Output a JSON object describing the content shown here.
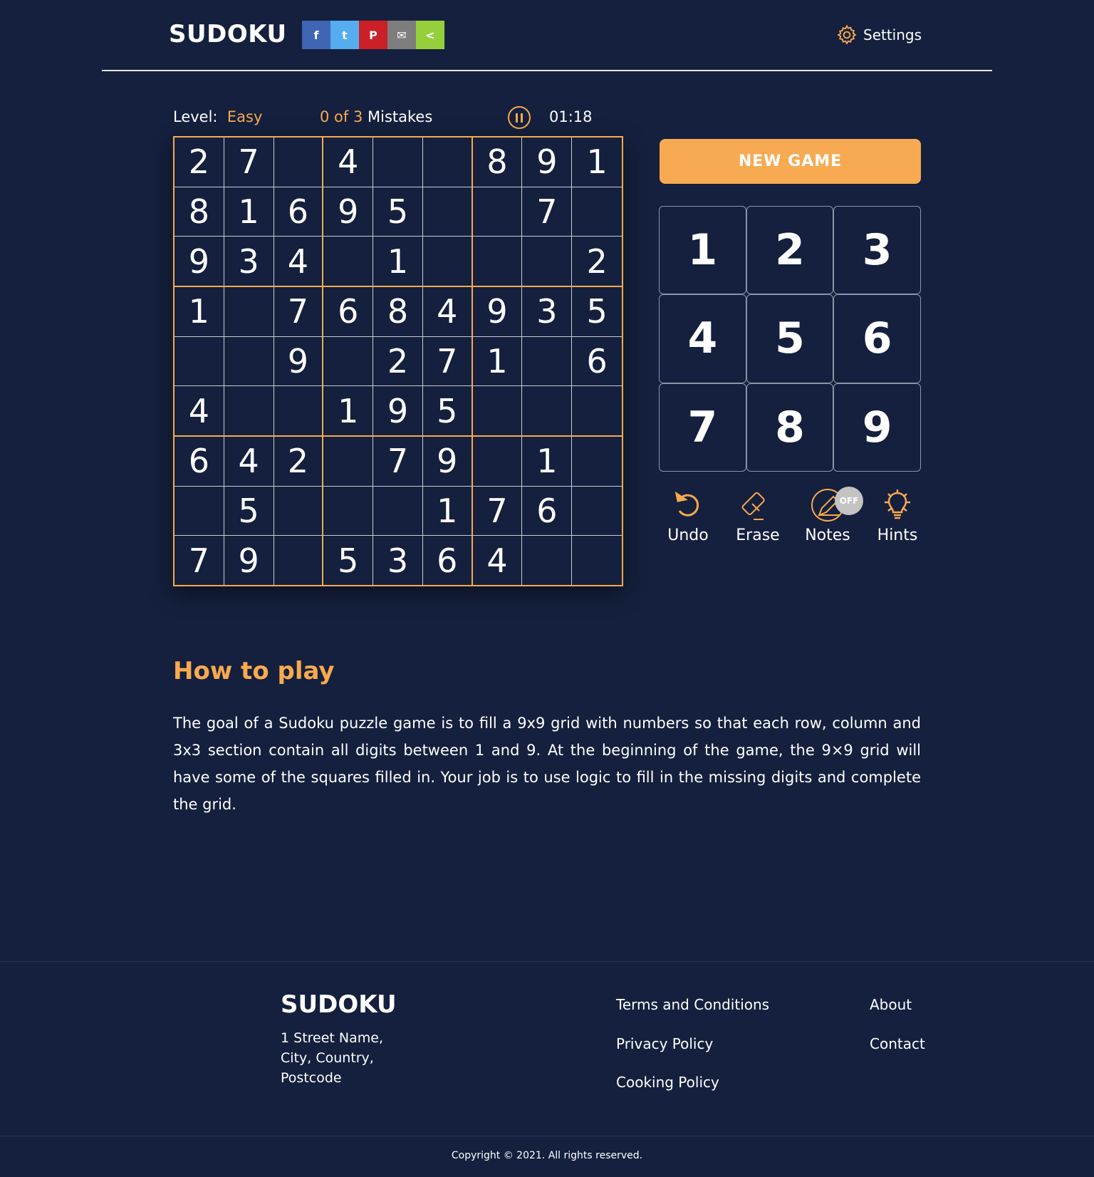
{
  "header": {
    "logo": "SUDOKU",
    "share": [
      {
        "icon": "facebook-icon",
        "glyph": "f",
        "color": "#3f65b4"
      },
      {
        "icon": "twitter-icon",
        "glyph": "t",
        "color": "#55acee"
      },
      {
        "icon": "pinterest-icon",
        "glyph": "P",
        "color": "#cb2027"
      },
      {
        "icon": "email-icon",
        "glyph": "✉",
        "color": "#7d7d7d"
      },
      {
        "icon": "share-icon",
        "glyph": "<",
        "color": "#95d03a"
      }
    ],
    "settings_label": "Settings"
  },
  "status": {
    "level_label": "Level:",
    "level": "Easy",
    "mistakes_count": "0 of 3",
    "mistakes_label": "Mistakes",
    "timer": "01:18"
  },
  "grid": [
    [
      "2",
      "7",
      "",
      "4",
      "",
      "",
      "8",
      "9",
      "1"
    ],
    [
      "8",
      "1",
      "6",
      "9",
      "5",
      "",
      "",
      "7",
      ""
    ],
    [
      "9",
      "3",
      "4",
      "",
      "1",
      "",
      "",
      "",
      "2"
    ],
    [
      "1",
      "",
      "7",
      "6",
      "8",
      "4",
      "9",
      "3",
      "5"
    ],
    [
      "",
      "",
      "9",
      "",
      "2",
      "7",
      "1",
      "",
      "6"
    ],
    [
      "4",
      "",
      "",
      "1",
      "9",
      "5",
      "",
      "",
      ""
    ],
    [
      "6",
      "4",
      "2",
      "",
      "7",
      "9",
      "",
      "1",
      ""
    ],
    [
      "",
      "5",
      "",
      "",
      "",
      "1",
      "7",
      "6",
      ""
    ],
    [
      "7",
      "9",
      "",
      "5",
      "3",
      "6",
      "4",
      "",
      ""
    ]
  ],
  "new_game": "NEW GAME",
  "numpad": [
    "1",
    "2",
    "3",
    "4",
    "5",
    "6",
    "7",
    "8",
    "9"
  ],
  "tools": {
    "undo": "Undo",
    "erase": "Erase",
    "notes": "Notes",
    "notes_state": "OFF",
    "hints": "Hints"
  },
  "how_to": {
    "title": "How to play",
    "text": "The goal of a Sudoku puzzle game is to fill a 9x9 grid with numbers so that each row, column and 3x3 section contain all digits between 1 and 9. At the beginning of the game, the 9×9 grid will have some of the squares filled in. Your job is to use logic to fill in the missing digits and complete the grid."
  },
  "footer": {
    "logo": "SUDOKU",
    "address": [
      "1 Street Name,",
      "City, Country,",
      "Postcode"
    ],
    "links": [
      "Terms and Conditions",
      "Privacy Policy",
      "Cooking Policy",
      "About",
      "Contact"
    ],
    "copyright": "Copyright © 2021. All rights reserved."
  },
  "colors": {
    "background": "#14203d",
    "accent": "#f9a94e"
  }
}
